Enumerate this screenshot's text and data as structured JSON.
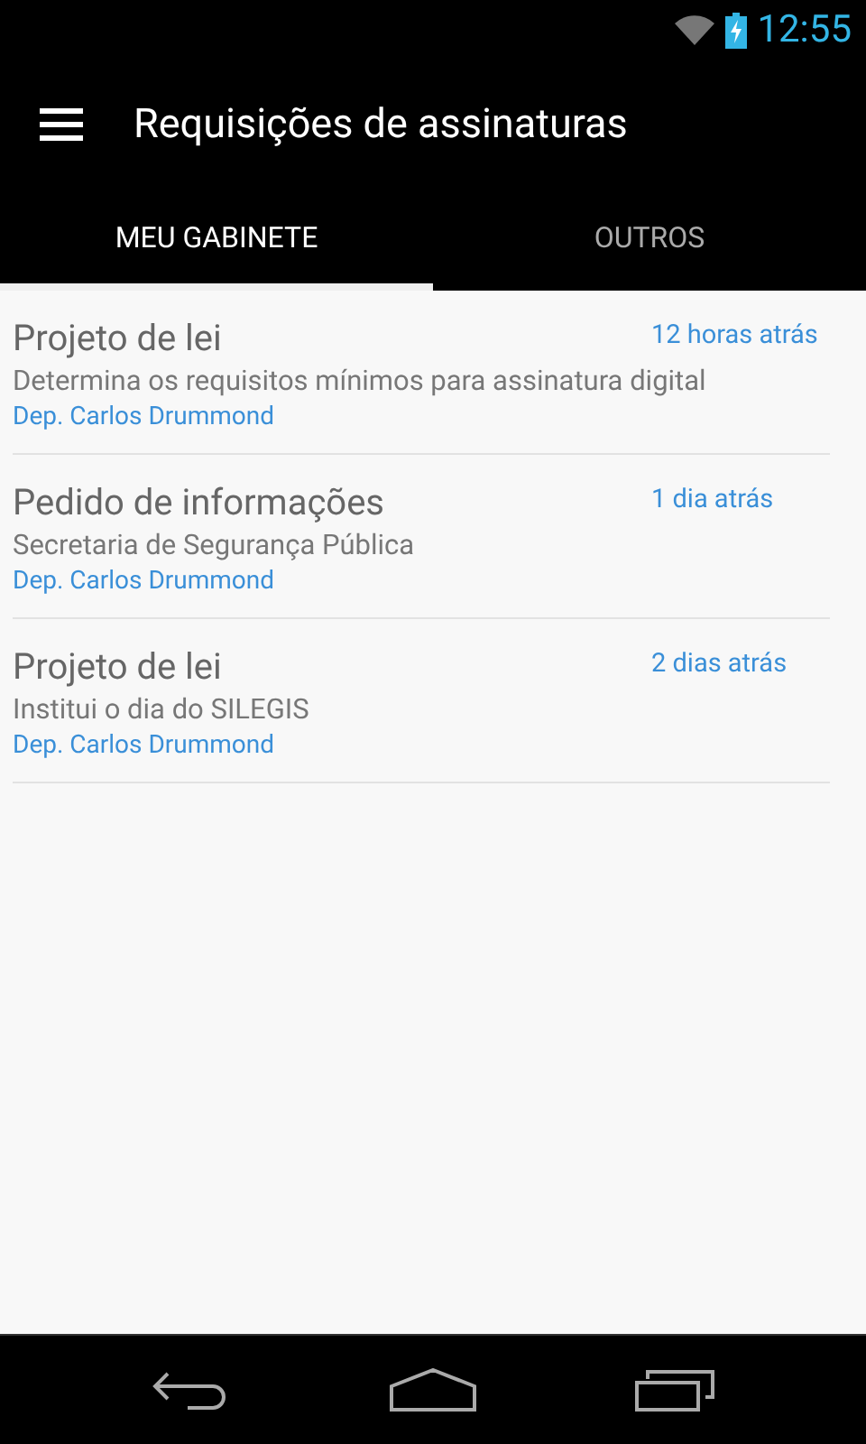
{
  "status_bar": {
    "time": "12:55"
  },
  "toolbar": {
    "title": "Requisições de assinaturas"
  },
  "tabs": [
    {
      "label": "MEU GABINETE",
      "selected": true
    },
    {
      "label": "OUTROS",
      "selected": false
    }
  ],
  "requests": [
    {
      "type": "Projeto de lei",
      "description": "Determina os requisitos mínimos para assinatura digital",
      "author": "Dep. Carlos Drummond",
      "time": "12 horas atrás"
    },
    {
      "type": "Pedido de informações",
      "description": "Secretaria de Segurança Pública",
      "author": "Dep. Carlos Drummond",
      "time": "1 dia atrás"
    },
    {
      "type": "Projeto de lei",
      "description": "Institui o dia do SILEGIS",
      "author": "Dep. Carlos Drummond",
      "time": "2 dias atrás"
    }
  ]
}
